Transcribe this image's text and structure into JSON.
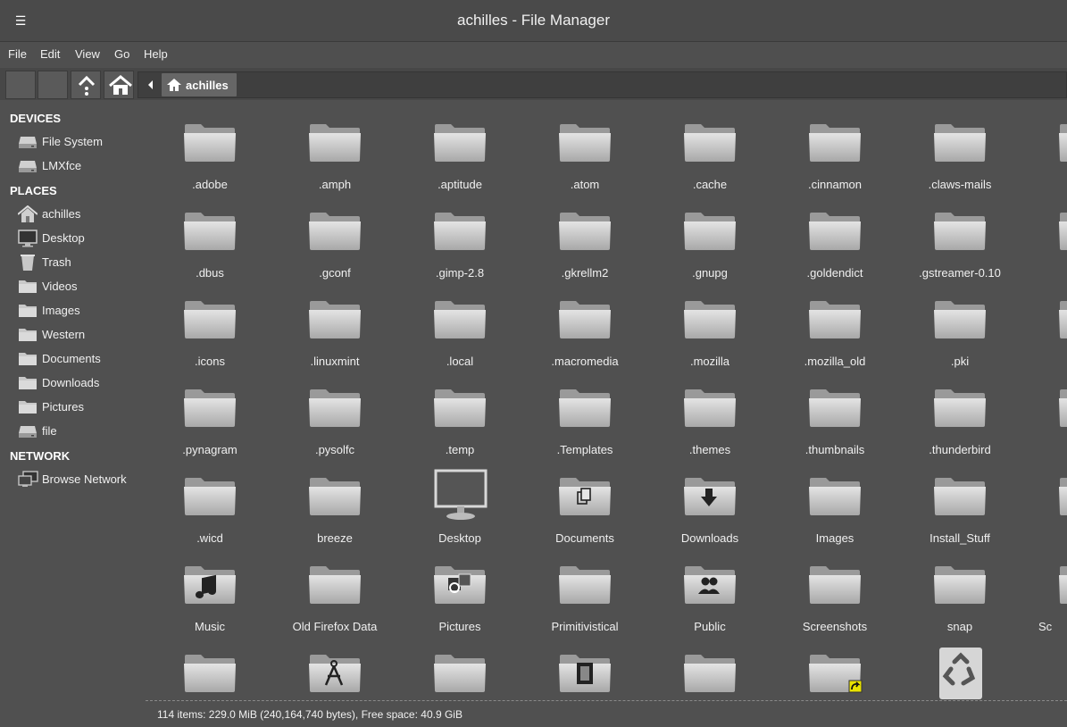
{
  "window": {
    "title": "achilles - File Manager"
  },
  "menu": {
    "items": [
      "File",
      "Edit",
      "View",
      "Go",
      "Help"
    ]
  },
  "path": {
    "crumb": "achilles"
  },
  "sidebar": {
    "devices_title": "DEVICES",
    "devices": [
      {
        "label": "File System",
        "icon": "drive-icon"
      },
      {
        "label": "LMXfce",
        "icon": "drive-icon"
      }
    ],
    "places_title": "PLACES",
    "places": [
      {
        "label": "achilles",
        "icon": "home-icon"
      },
      {
        "label": "Desktop",
        "icon": "monitor-icon"
      },
      {
        "label": "Trash",
        "icon": "trash-icon"
      },
      {
        "label": "Videos",
        "icon": "folder-icon"
      },
      {
        "label": "Images",
        "icon": "folder-icon"
      },
      {
        "label": "Western",
        "icon": "folder-icon"
      },
      {
        "label": "Documents",
        "icon": "folder-icon"
      },
      {
        "label": "Downloads",
        "icon": "folder-icon"
      },
      {
        "label": "Pictures",
        "icon": "folder-icon"
      },
      {
        "label": "file",
        "icon": "drive-icon"
      }
    ],
    "network_title": "NETWORK",
    "network": [
      {
        "label": "Browse Network",
        "icon": "network-icon"
      }
    ]
  },
  "files": [
    [
      ".adobe",
      ".amph",
      ".aptitude",
      ".atom",
      ".cache",
      ".cinnamon",
      ".claws-mails"
    ],
    [
      ".dbus",
      ".gconf",
      ".gimp-2.8",
      ".gkrellm2",
      ".gnupg",
      ".goldendict",
      ".gstreamer-0.10"
    ],
    [
      ".icons",
      ".linuxmint",
      ".local",
      ".macromedia",
      ".mozilla",
      ".mozilla_old",
      ".pki"
    ],
    [
      ".pynagram",
      ".pysolfc",
      ".temp",
      ".Templates",
      ".themes",
      ".thumbnails",
      ".thunderbird"
    ],
    [
      ".wicd",
      "breeze",
      "Desktop",
      "Documents",
      "Downloads",
      "Images",
      "Install_Stuff"
    ],
    [
      "Music",
      "Old Firefox Data",
      "Pictures",
      "Primitivistical",
      "Public",
      "Screenshots",
      "snap"
    ]
  ],
  "file_icons": [
    [
      "folder",
      "folder",
      "folder",
      "folder",
      "folder",
      "folder",
      "folder"
    ],
    [
      "folder",
      "folder",
      "folder",
      "folder",
      "folder",
      "folder",
      "folder"
    ],
    [
      "folder",
      "folder",
      "folder",
      "folder",
      "folder",
      "folder",
      "folder"
    ],
    [
      "folder",
      "folder",
      "folder",
      "folder",
      "folder",
      "folder",
      "folder"
    ],
    [
      "folder",
      "folder",
      "monitor",
      "documents",
      "downloads",
      "folder",
      "folder"
    ],
    [
      "music",
      "folder",
      "pictures",
      "folder",
      "public",
      "folder",
      "folder"
    ]
  ],
  "partial_label": "Sc",
  "bottom_row_icons": [
    "folder",
    "templates",
    "folder",
    "videos",
    "folder",
    "symlink",
    "trash"
  ],
  "status": {
    "text": "114 items: 229.0 MiB (240,164,740 bytes), Free space: 40.9 GiB"
  }
}
